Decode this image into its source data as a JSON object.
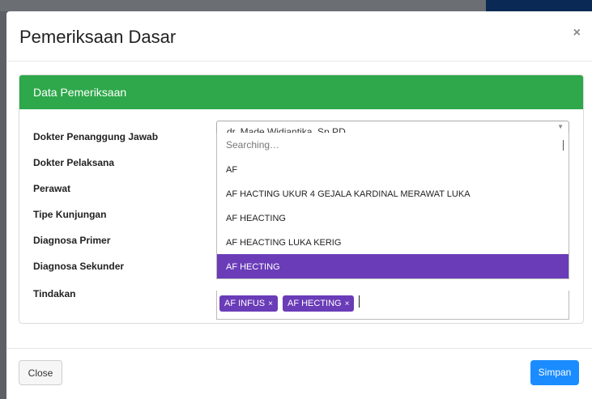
{
  "modal": {
    "title": "Pemeriksaan Dasar",
    "close_icon": "×"
  },
  "card": {
    "header": "Data Pemeriksaan",
    "fields": [
      {
        "label": "Dokter Penanggung Jawab"
      },
      {
        "label": "Dokter Pelaksana"
      },
      {
        "label": "Perawat"
      },
      {
        "label": "Tipe Kunjungan"
      },
      {
        "label": "Diagnosa Primer"
      },
      {
        "label": "Diagnosa Sekunder"
      },
      {
        "label": "Tindakan"
      }
    ],
    "doctor_select_value": "dr. Made Widiantika, Sp.PD",
    "dropdown": {
      "search_text": "Searching…",
      "options": [
        "AF",
        "AF HACTING UKUR 4 GEJALA KARDINAL MERAWAT LUKA",
        "AF HEACTING",
        "AF HEACTING LUKA KERIG",
        "AF HECTING"
      ],
      "selected_index": 4
    },
    "tags": [
      "AF INFUS",
      "AF HECTING"
    ],
    "tag_remove": "×"
  },
  "footer": {
    "close_label": "Close",
    "save_label": "Simpan"
  },
  "colors": {
    "header_green": "#2ea84a",
    "tag_purple": "#6a3cb8",
    "primary_blue": "#1a8cff"
  }
}
